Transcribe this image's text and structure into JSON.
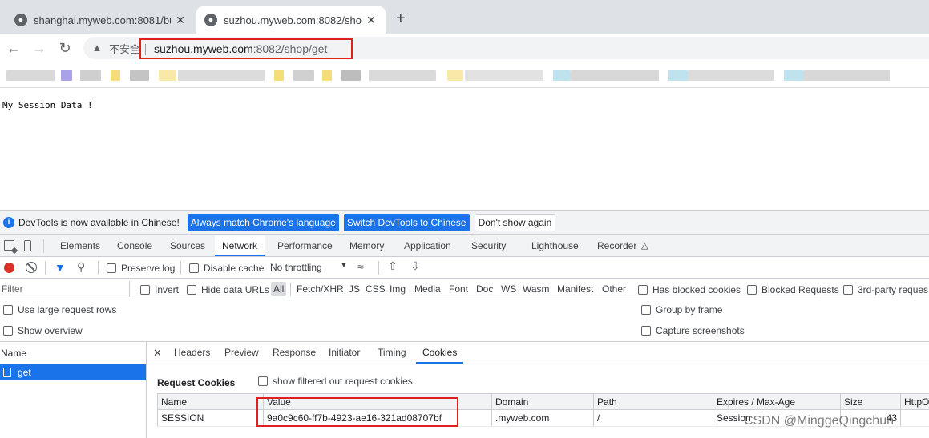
{
  "browser": {
    "tabs": [
      {
        "title": "shanghai.myweb.com:8081/bu",
        "active": false
      },
      {
        "title": "suzhou.myweb.com:8082/shop",
        "active": true
      }
    ],
    "address": {
      "security_label": "不安全",
      "host": "suzhou.myweb.com",
      "rest": ":8082/shop/get"
    }
  },
  "page": {
    "body_text": "My Session Data !"
  },
  "devtools": {
    "infobar": {
      "message": "DevTools is now available in Chinese!",
      "btn_match": "Always match Chrome's language",
      "btn_switch": "Switch DevTools to Chinese",
      "btn_dismiss": "Don't show again"
    },
    "tabs": [
      "Elements",
      "Console",
      "Sources",
      "Network",
      "Performance",
      "Memory",
      "Application",
      "Security",
      "Lighthouse",
      "Recorder"
    ],
    "active_tab": "Network",
    "network_toolbar": {
      "preserve_log": "Preserve log",
      "disable_cache": "Disable cache",
      "throttling": "No throttling"
    },
    "filter": {
      "placeholder": "Filter",
      "invert": "Invert",
      "hide_data_urls": "Hide data URLs",
      "types": [
        "All",
        "Fetch/XHR",
        "JS",
        "CSS",
        "Img",
        "Media",
        "Font",
        "Doc",
        "WS",
        "Wasm",
        "Manifest",
        "Other"
      ],
      "has_blocked_cookies": "Has blocked cookies",
      "blocked_requests": "Blocked Requests",
      "third_party": "3rd-party reques"
    },
    "options": {
      "large_rows": "Use large request rows",
      "show_overview": "Show overview",
      "group_by_frame": "Group by frame",
      "capture_screenshots": "Capture screenshots"
    },
    "requests": {
      "header": "Name",
      "items": [
        "get"
      ]
    },
    "detail_tabs": [
      "Headers",
      "Preview",
      "Response",
      "Initiator",
      "Timing",
      "Cookies"
    ],
    "active_detail_tab": "Cookies",
    "cookies": {
      "title": "Request Cookies",
      "show_filtered": "show filtered out request cookies",
      "columns": [
        "Name",
        "Value",
        "Domain",
        "Path",
        "Expires / Max-Age",
        "Size",
        "HttpO"
      ],
      "rows": [
        {
          "name": "SESSION",
          "value": "9a0c9c60-ff7b-4923-ae16-321ad08707bf",
          "domain": ".myweb.com",
          "path": "/",
          "expires": "Session",
          "size": "43",
          "httponly": ""
        }
      ]
    }
  },
  "watermark": "CSDN @MinggeQingchun",
  "colors": {
    "accent": "#1a73e8",
    "highlight_box": "#e02020",
    "record": "#d93025"
  }
}
